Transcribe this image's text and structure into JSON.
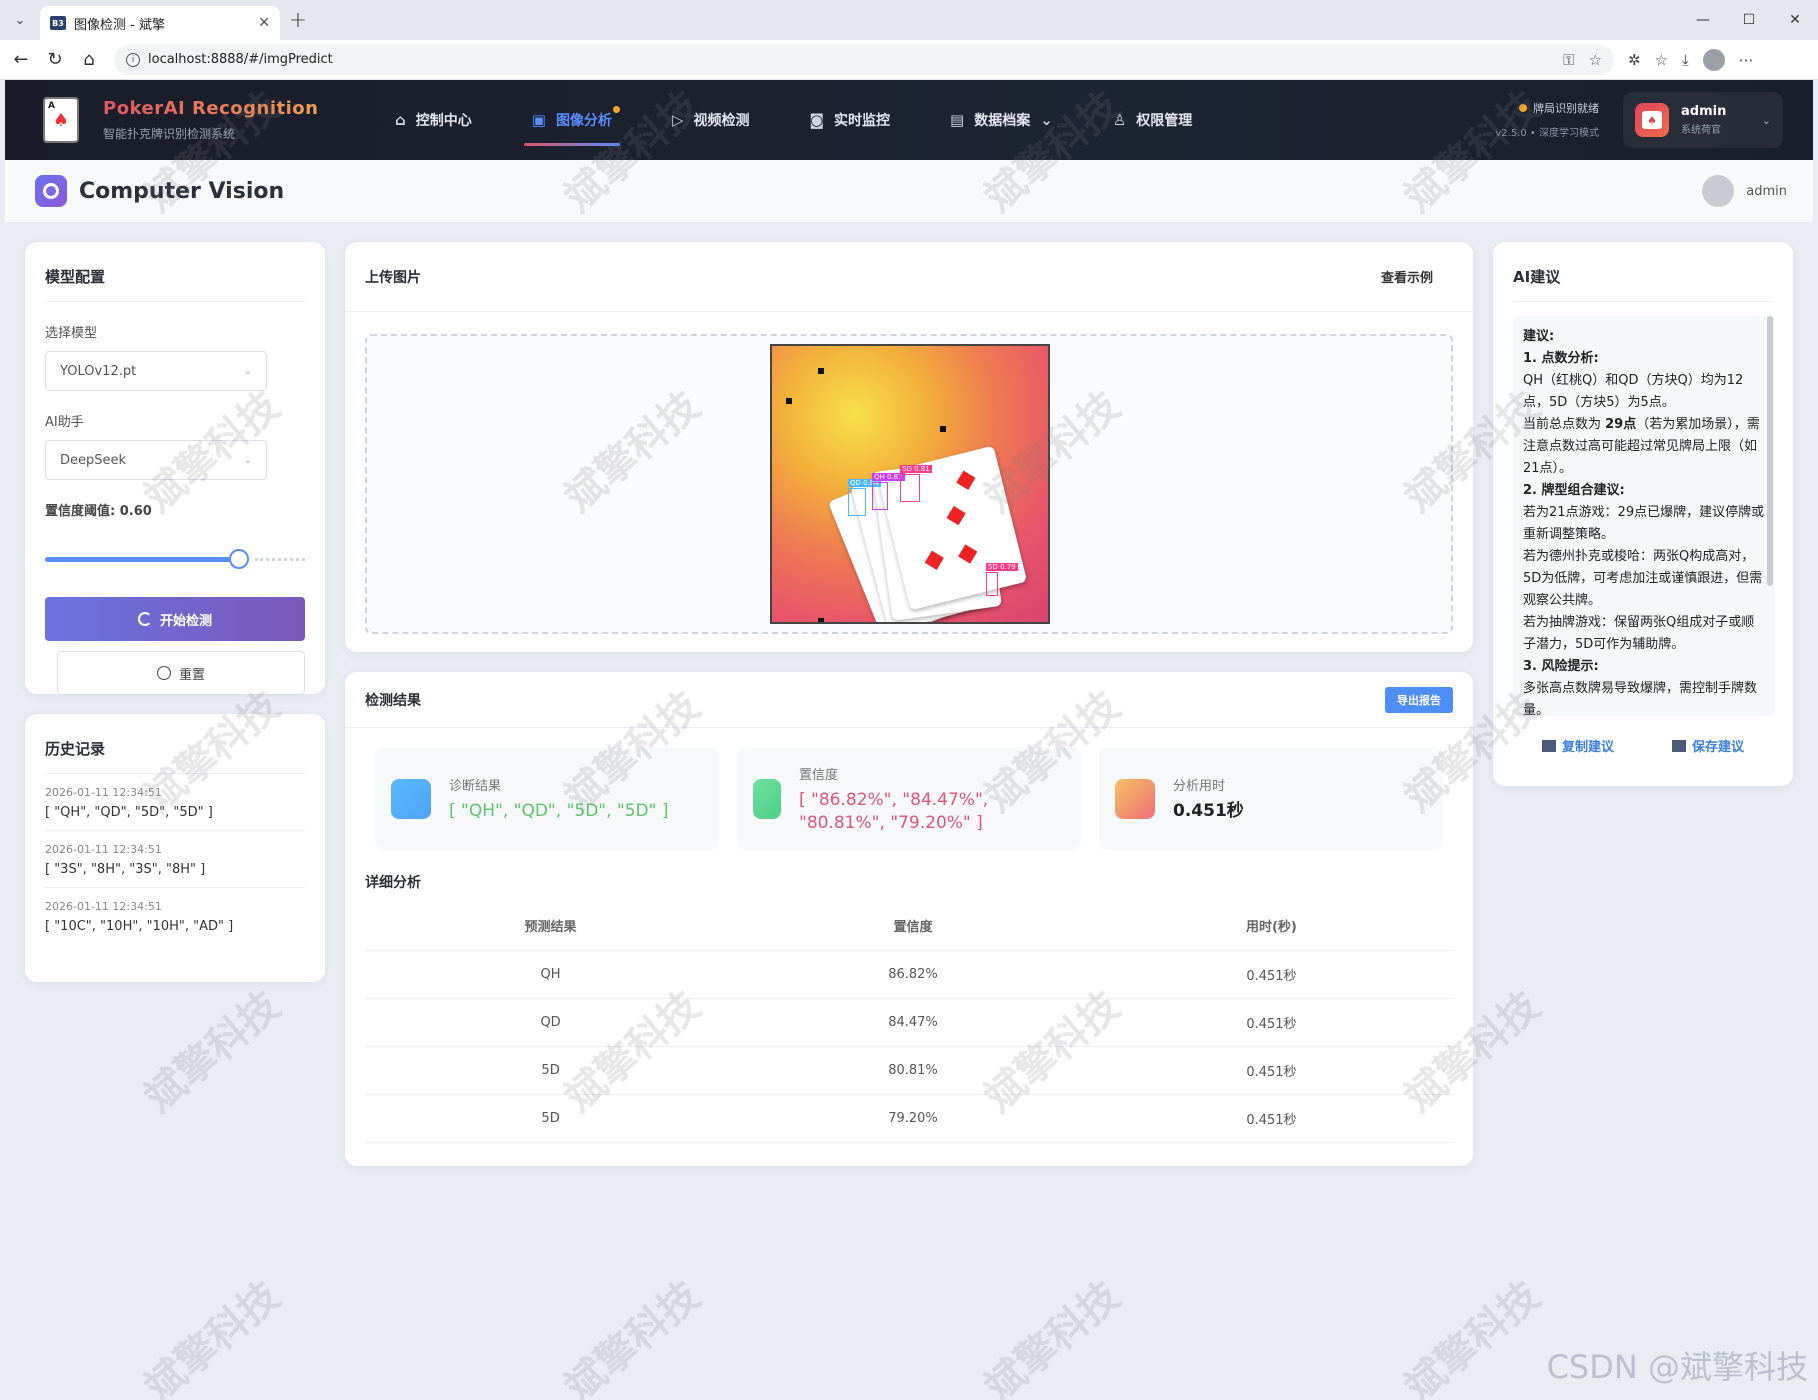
{
  "browser": {
    "tab_favicon": "B3",
    "tab_title": "图像检测 - 斌擎",
    "url": "localhost:8888/#/imgPredict"
  },
  "header": {
    "brand_title": "PokerAI Recognition",
    "brand_subtitle": "智能扑克牌识别检测系统",
    "nav": [
      {
        "label": "控制中心",
        "icon": "home-icon"
      },
      {
        "label": "图像分析",
        "icon": "image-icon",
        "active": true
      },
      {
        "label": "视频检测",
        "icon": "play-circle-icon"
      },
      {
        "label": "实时监控",
        "icon": "camera-icon"
      },
      {
        "label": "数据档案",
        "icon": "document-icon",
        "dropdown": true
      },
      {
        "label": "权限管理",
        "icon": "user-icon"
      }
    ],
    "status_line1": "牌局识别就绪",
    "status_line2": "v2.5.0 • 深度学习模式",
    "user_name": "admin",
    "user_role": "系统荷官"
  },
  "subheader": {
    "title": "Computer Vision",
    "user": "admin"
  },
  "config": {
    "title": "模型配置",
    "model_label": "选择模型",
    "model_value": "YOLOv12.pt",
    "assistant_label": "AI助手",
    "assistant_value": "DeepSeek",
    "threshold_label": "置信度阈值: 0.60",
    "threshold_value": 0.6,
    "start_button": "开始检测",
    "reset_button": "重置"
  },
  "history": {
    "title": "历史记录",
    "items": [
      {
        "time": "2026-01-11 12:34:51",
        "values": "[ \"QH\", \"QD\", \"5D\", \"5D\" ]"
      },
      {
        "time": "2026-01-11 12:34:51",
        "values": "[ \"3S\", \"8H\", \"3S\", \"8H\" ]"
      },
      {
        "time": "2026-01-11 12:34:51",
        "values": "[ \"10C\", \"10H\", \"10H\", \"AD\" ]"
      }
    ]
  },
  "upload": {
    "title": "上传图片",
    "example_link": "查看示例",
    "detections": [
      {
        "label": "QD 0.84"
      },
      {
        "label": "QH 0.87"
      },
      {
        "label": "5D 0.81"
      },
      {
        "label": "5D 0.79"
      }
    ]
  },
  "results": {
    "title": "检测结果",
    "export_button": "导出报告",
    "metrics": [
      {
        "label": "诊断结果",
        "value": "[ \"QH\", \"QD\", \"5D\", \"5D\" ]",
        "color": "#5ec46a"
      },
      {
        "label": "置信度",
        "value": "[ \"86.82%\", \"84.47%\", \"80.81%\", \"79.20%\" ]",
        "color": "#e0557a"
      },
      {
        "label": "分析用时",
        "value": "0.451秒",
        "color": "#222222"
      }
    ],
    "detail_title": "详细分析",
    "columns": [
      "预测结果",
      "置信度",
      "用时(秒)"
    ],
    "rows": [
      [
        "QH",
        "86.82%",
        "0.451秒"
      ],
      [
        "QD",
        "84.47%",
        "0.451秒"
      ],
      [
        "5D",
        "80.81%",
        "0.451秒"
      ],
      [
        "5D",
        "79.20%",
        "0.451秒"
      ]
    ]
  },
  "ai": {
    "title": "AI建议",
    "copy_button": "复制建议",
    "save_button": "保存建议",
    "lines": [
      {
        "b": "建议:",
        "t": ""
      },
      {
        "b": "1. 点数分析:",
        "t": ""
      },
      {
        "b": "",
        "t": "QH（红桃Q）和QD（方块Q）均为12点，5D（方块5）为5点。"
      },
      {
        "b": "",
        "t": "当前总点数为 "
      },
      {
        "b": "2. 牌型组合建议:",
        "t": ""
      },
      {
        "b": "",
        "t": "若为21点游戏：29点已爆牌，建议停牌或重新调整策略。"
      },
      {
        "b": "",
        "t": "若为德州扑克或梭哈：两张Q构成高对，5D为低牌，可考虑加注或谨慎跟进，但需观察公共牌。"
      },
      {
        "b": "",
        "t": "若为抽牌游戏：保留两张Q组成对子或顺子潜力，5D可作为辅助牌。"
      },
      {
        "b": "3. 风险提示:",
        "t": ""
      },
      {
        "b": "",
        "t": "多张高点数牌易导致爆牌，需控制手牌数量。"
      }
    ],
    "total_points": "29点",
    "total_suffix": "（若为累加场景），需注意点数过高可能超过常见牌局上限（如21点）。"
  },
  "watermark": "斌擎科技",
  "footer_mark": "CSDN @斌擎科技"
}
